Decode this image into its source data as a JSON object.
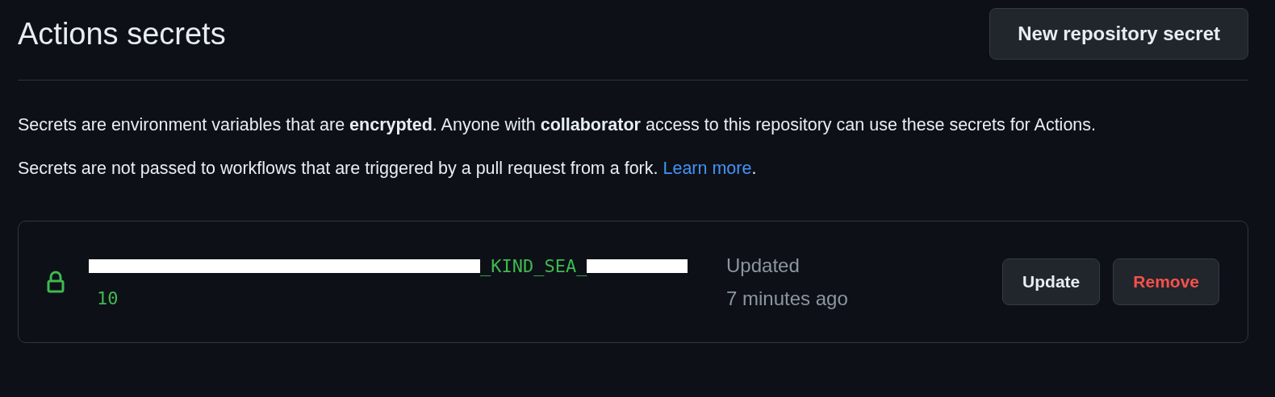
{
  "header": {
    "title": "Actions secrets",
    "button": "New repository secret"
  },
  "paragraphs": [
    "Secrets are environment variables that are **encrypted**. Anyone with **collaborator** access to this repository can use these secrets for Actions."
  ],
  "fork_note": {
    "text": "Secrets are not passed to workflows that are triggered by a pull request from a fork.",
    "link": "Learn more",
    "after": "."
  },
  "secrets": [
    {
      "name_visible": "_KIND_SEA_",
      "name_line_2": "10",
      "redacted": true,
      "updated_label": "Updated",
      "updated_time": "7 minutes ago",
      "actions": [
        {
          "label": "Update",
          "kind": "normal"
        },
        {
          "label": "Remove",
          "kind": "danger"
        }
      ]
    }
  ]
}
